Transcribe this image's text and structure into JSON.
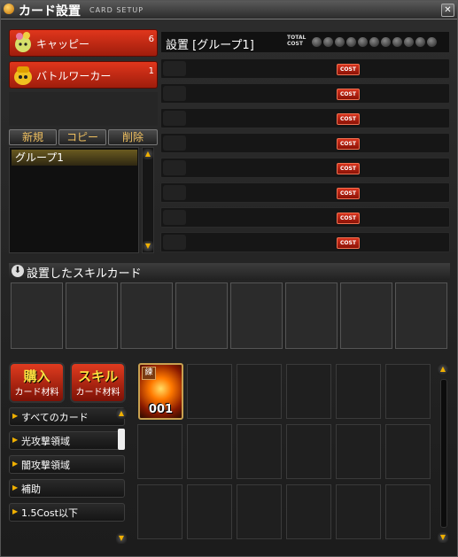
{
  "window": {
    "title": "カード設置",
    "subtitle": "CARD SETUP",
    "close_symbol": "✕"
  },
  "party": [
    {
      "name": "キャッピー",
      "count": "6"
    },
    {
      "name": "バトルワーカー",
      "count": "1"
    }
  ],
  "groups": {
    "buttons": {
      "new": "新規",
      "copy": "コピー",
      "delete": "削除"
    },
    "items": [
      "グループ1"
    ]
  },
  "slots": {
    "title": "設置 [グループ1]",
    "total_cost_label_1": "TOTAL",
    "total_cost_label_2": "COST",
    "cost_label": "COST",
    "row_count": 8
  },
  "skill_cards": {
    "title": "設置したスキルカード"
  },
  "shop": [
    {
      "big": "購入",
      "small": "カード材料"
    },
    {
      "big": "スキル",
      "small": "カード材料"
    }
  ],
  "filters": [
    "すべてのカード",
    "光攻撃領域",
    "闇攻撃領域",
    "補助",
    "1.5Cost以下"
  ],
  "inventory": {
    "card": {
      "tag": "練",
      "number": "001"
    }
  },
  "colors": {
    "accent_red": "#d7331d",
    "accent_gold": "#f0b000"
  }
}
